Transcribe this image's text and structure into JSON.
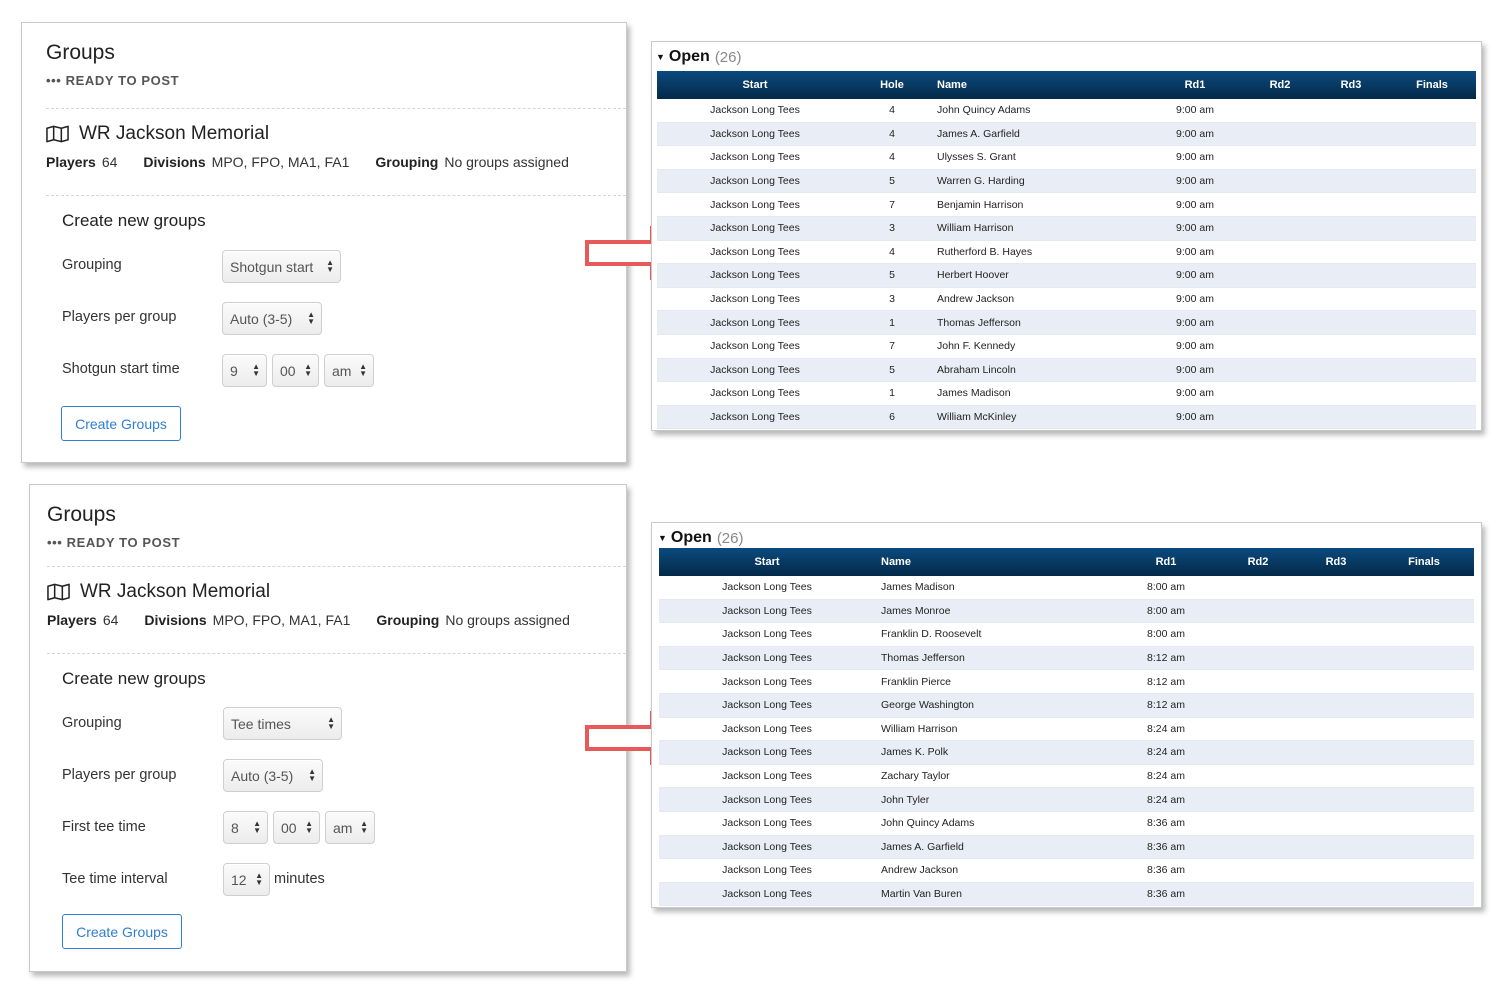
{
  "panels": [
    {
      "title": "Groups",
      "status": "••• READY TO POST",
      "event_name": "WR Jackson Memorial",
      "meta": {
        "players_label": "Players",
        "players": "64",
        "divisions_label": "Divisions",
        "divisions": "MPO, FPO, MA1, FA1",
        "grouping_label": "Grouping",
        "grouping": "No groups assigned"
      },
      "create_title": "Create new groups",
      "grouping_label": "Grouping",
      "grouping_value": "Shotgun start",
      "players_per_group_label": "Players per group",
      "players_per_group_value": "Auto (3-5)",
      "time_label": "Shotgun start time",
      "hour": "9",
      "minute": "00",
      "ampm": "am",
      "button": "Create Groups"
    },
    {
      "title": "Groups",
      "status": "••• READY TO POST",
      "event_name": "WR Jackson Memorial",
      "meta": {
        "players_label": "Players",
        "players": "64",
        "divisions_label": "Divisions",
        "divisions": "MPO, FPO, MA1, FA1",
        "grouping_label": "Grouping",
        "grouping": "No groups assigned"
      },
      "create_title": "Create new groups",
      "grouping_label": "Grouping",
      "grouping_value": "Tee times",
      "players_per_group_label": "Players per group",
      "players_per_group_value": "Auto (3-5)",
      "time_label": "First tee time",
      "hour": "8",
      "minute": "00",
      "ampm": "am",
      "interval_label": "Tee time interval",
      "interval_value": "12",
      "interval_unit": "minutes",
      "button": "Create Groups"
    }
  ],
  "tables": [
    {
      "division": "Open",
      "count": "(26)",
      "columns": [
        "Start",
        "Hole",
        "Name",
        "Rd1",
        "Rd2",
        "Rd3",
        "Finals"
      ],
      "rows": [
        [
          "Jackson Long Tees",
          "4",
          "John Quincy Adams",
          "9:00 am"
        ],
        [
          "Jackson Long Tees",
          "4",
          "James A. Garfield",
          "9:00 am"
        ],
        [
          "Jackson Long Tees",
          "4",
          "Ulysses S. Grant",
          "9:00 am"
        ],
        [
          "Jackson Long Tees",
          "5",
          "Warren G. Harding",
          "9:00 am"
        ],
        [
          "Jackson Long Tees",
          "7",
          "Benjamin Harrison",
          "9:00 am"
        ],
        [
          "Jackson Long Tees",
          "3",
          "William Harrison",
          "9:00 am"
        ],
        [
          "Jackson Long Tees",
          "4",
          "Rutherford B. Hayes",
          "9:00 am"
        ],
        [
          "Jackson Long Tees",
          "5",
          "Herbert Hoover",
          "9:00 am"
        ],
        [
          "Jackson Long Tees",
          "3",
          "Andrew Jackson",
          "9:00 am"
        ],
        [
          "Jackson Long Tees",
          "1",
          "Thomas Jefferson",
          "9:00 am"
        ],
        [
          "Jackson Long Tees",
          "7",
          "John F. Kennedy",
          "9:00 am"
        ],
        [
          "Jackson Long Tees",
          "5",
          "Abraham Lincoln",
          "9:00 am"
        ],
        [
          "Jackson Long Tees",
          "1",
          "James Madison",
          "9:00 am"
        ],
        [
          "Jackson Long Tees",
          "6",
          "William McKinley",
          "9:00 am"
        ]
      ]
    },
    {
      "division": "Open",
      "count": "(26)",
      "columns": [
        "Start",
        "Name",
        "Rd1",
        "Rd2",
        "Rd3",
        "Finals"
      ],
      "rows": [
        [
          "Jackson Long Tees",
          "James Madison",
          "8:00 am"
        ],
        [
          "Jackson Long Tees",
          "James Monroe",
          "8:00 am"
        ],
        [
          "Jackson Long Tees",
          "Franklin D. Roosevelt",
          "8:00 am"
        ],
        [
          "Jackson Long Tees",
          "Thomas Jefferson",
          "8:12 am"
        ],
        [
          "Jackson Long Tees",
          "Franklin Pierce",
          "8:12 am"
        ],
        [
          "Jackson Long Tees",
          "George Washington",
          "8:12 am"
        ],
        [
          "Jackson Long Tees",
          "William Harrison",
          "8:24 am"
        ],
        [
          "Jackson Long Tees",
          "James K. Polk",
          "8:24 am"
        ],
        [
          "Jackson Long Tees",
          "Zachary Taylor",
          "8:24 am"
        ],
        [
          "Jackson Long Tees",
          "John Tyler",
          "8:24 am"
        ],
        [
          "Jackson Long Tees",
          "John Quincy Adams",
          "8:36 am"
        ],
        [
          "Jackson Long Tees",
          "James A. Garfield",
          "8:36 am"
        ],
        [
          "Jackson Long Tees",
          "Andrew Jackson",
          "8:36 am"
        ],
        [
          "Jackson Long Tees",
          "Martin Van Buren",
          "8:36 am"
        ]
      ]
    }
  ],
  "colors": {
    "accent": "#2e7fd2",
    "table_header": "#063258",
    "row_alt": "#e9eef6",
    "arrow": "#e85a5a"
  }
}
